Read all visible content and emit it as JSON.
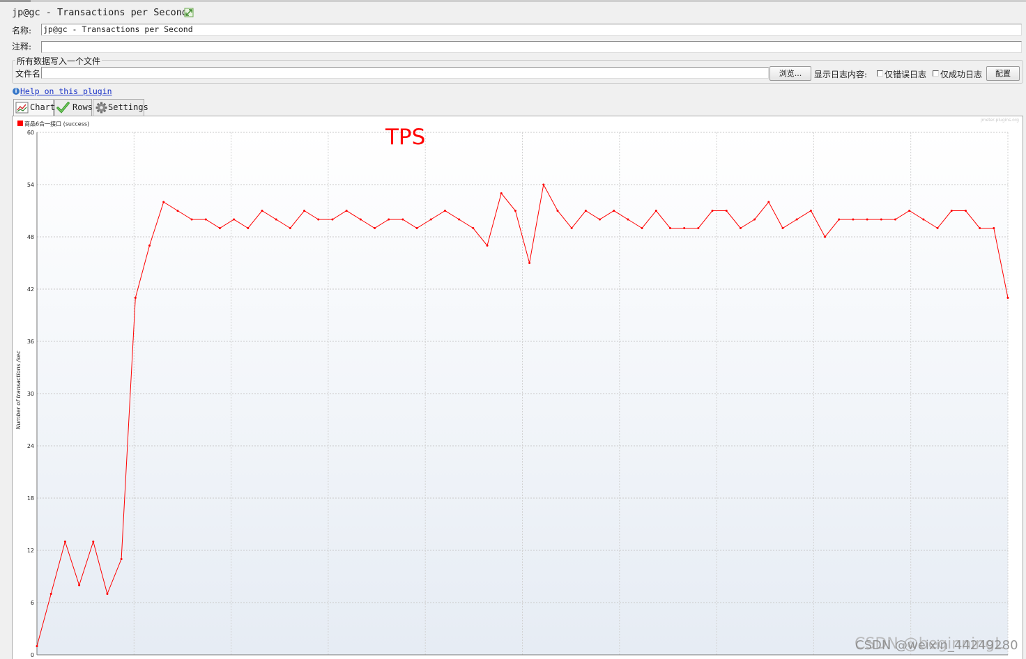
{
  "window": {
    "title": "jp@gc - Transactions per Second"
  },
  "form": {
    "name_label": "名称:",
    "name_value": "jp@gc - Transactions per Second",
    "comment_label": "注释:",
    "comment_value": "",
    "group_title": "所有数据写入一个文件",
    "filename_label": "文件名",
    "filename_value": "",
    "browse_button": "浏览...",
    "log_content_label": "显示日志内容:",
    "errors_only_label": "仅错误日志",
    "errors_only_checked": false,
    "success_only_label": "仅成功日志",
    "success_only_checked": false,
    "configure_button": "配置"
  },
  "help": {
    "link_text": "Help on this plugin"
  },
  "tabs": [
    {
      "label": "Chart",
      "icon": "chart-icon",
      "active": true
    },
    {
      "label": "Rows",
      "icon": "checkmark-icon",
      "active": false
    },
    {
      "label": "Settings",
      "icon": "gear-icon",
      "active": false
    }
  ],
  "annotation": {
    "text": "TPS",
    "color": "#ff0000"
  },
  "watermarks": {
    "corner": "jmeter-plugins.org",
    "csdn": "CSDN @weixin_44249280",
    "csdn_overlay": "CSDN @beginningL"
  },
  "chart_data": {
    "type": "line",
    "ylabel": "Number of transactions /sec",
    "ylim": [
      0,
      60
    ],
    "yticks": [
      0,
      6,
      12,
      18,
      24,
      30,
      36,
      42,
      48,
      54,
      60
    ],
    "x_ticks_visible": false,
    "grid": true,
    "legend_position": "top-left",
    "series": [
      {
        "name": "商品6合一接口 (success)",
        "color": "#ff0000",
        "values": [
          1,
          7,
          13,
          8,
          13,
          7,
          11,
          41,
          47,
          52,
          51,
          50,
          50,
          49,
          50,
          49,
          51,
          50,
          49,
          51,
          50,
          50,
          51,
          50,
          49,
          50,
          50,
          49,
          50,
          51,
          50,
          49,
          47,
          53,
          51,
          45,
          54,
          51,
          49,
          51,
          50,
          51,
          50,
          49,
          51,
          49,
          49,
          49,
          51,
          51,
          49,
          50,
          52,
          49,
          50,
          51,
          48,
          50,
          50,
          50,
          50,
          50,
          51,
          50,
          49,
          51,
          51,
          49,
          49,
          41
        ]
      }
    ]
  }
}
